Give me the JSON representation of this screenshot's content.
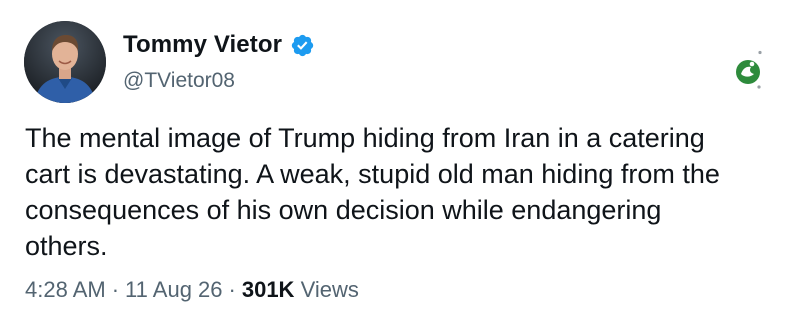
{
  "author": {
    "display_name": "Tommy Vietor",
    "handle": "@TVietor08",
    "verified": true,
    "verified_color": "#1d9bf0"
  },
  "tweet": {
    "text": "The mental image of Trump hiding from Iran in a catering\ncart is devastating. A weak, stupid old man hiding from the\nconsequences of his own decision while endangering\nothers."
  },
  "meta": {
    "time": "4:28 AM",
    "separator": "·",
    "date": "11 Aug 26",
    "views_count": "301K",
    "views_label": "Views"
  },
  "icons": {
    "avatar": "profile-photo",
    "verified": "verified-check-icon",
    "watermark": "channel-logo-icon"
  },
  "colors": {
    "text_primary": "#0f1419",
    "text_secondary": "#536471",
    "watermark_green": "#2e8b3c"
  }
}
